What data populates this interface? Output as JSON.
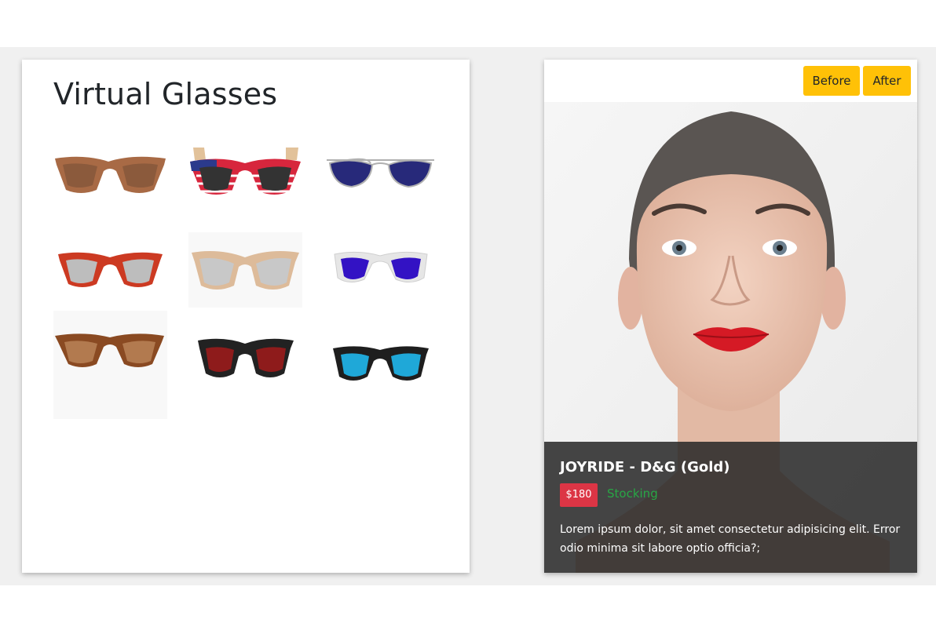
{
  "catalog": {
    "title": "Virtual Glasses",
    "items": [
      {
        "name": "brown-wayfarer",
        "frame": "#a86a45",
        "lens": "#8b5a3c"
      },
      {
        "name": "flag-wayfarer",
        "frame": "#d7263d",
        "lens": "#333333"
      },
      {
        "name": "silver-aviator",
        "frame": "#b0b0b0",
        "lens": "#27297a"
      },
      {
        "name": "red-wayfarer",
        "frame": "#cc3a22",
        "lens": "#bdbdbd"
      },
      {
        "name": "clear-cateye",
        "frame": "#d9b48f",
        "lens": "#c8c8c8"
      },
      {
        "name": "clear-blue-sport",
        "frame": "#e6e6e6",
        "lens": "#3312c4"
      },
      {
        "name": "tortoise-wayfarer",
        "frame": "#8a4a22",
        "lens": "#b27a4f"
      },
      {
        "name": "black-red-wayfarer",
        "frame": "#222222",
        "lens": "#8e1b1b"
      },
      {
        "name": "black-blue-mirror",
        "frame": "#1e1e1e",
        "lens": "#1fa8d8"
      }
    ]
  },
  "viewer": {
    "before_label": "Before",
    "after_label": "After",
    "product": {
      "name": "JOYRIDE - D&G (Gold)",
      "price": "$180",
      "status": "Stocking",
      "description": "Lorem ipsum dolor, sit amet consectetur adipisicing elit. Error odio minima sit labore optio officia?;"
    }
  },
  "colors": {
    "accent": "#ffc107",
    "price_badge": "#dc3545",
    "stock_status": "#28a745",
    "overlay": "#282828",
    "band_background": "#f0f0f0"
  }
}
